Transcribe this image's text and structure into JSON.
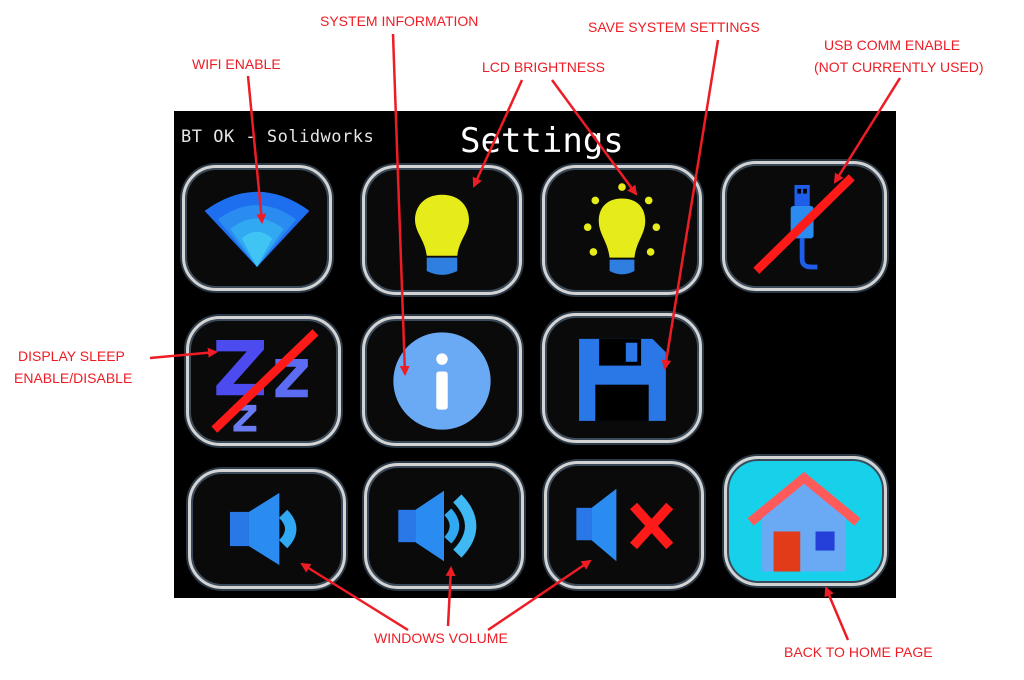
{
  "screen": {
    "status_text": "BT OK - Solidworks",
    "title": "Settings"
  },
  "buttons": [
    {
      "name": "wifi-toggle-button",
      "icon": "wifi-icon"
    },
    {
      "name": "lcd-brightness-down-button",
      "icon": "lightbulb-icon"
    },
    {
      "name": "lcd-brightness-up-button",
      "icon": "lightbulb-bright-icon"
    },
    {
      "name": "usb-comm-toggle-button",
      "icon": "usb-disabled-icon"
    },
    {
      "name": "display-sleep-toggle-button",
      "icon": "sleep-disabled-icon"
    },
    {
      "name": "system-info-button",
      "icon": "info-icon"
    },
    {
      "name": "save-settings-button",
      "icon": "floppy-disk-icon"
    },
    {
      "name": "volume-down-button",
      "icon": "speaker-low-icon"
    },
    {
      "name": "volume-up-button",
      "icon": "speaker-high-icon"
    },
    {
      "name": "volume-mute-button",
      "icon": "speaker-mute-icon"
    },
    {
      "name": "home-button",
      "icon": "house-icon"
    }
  ],
  "callouts": {
    "wifi": "WIFI ENABLE",
    "system_info": "SYSTEM INFORMATION",
    "lcd": "LCD BRIGHTNESS",
    "save": "SAVE SYSTEM SETTINGS",
    "usb_line1": "USB COMM ENABLE",
    "usb_line2": "(NOT CURRENTLY USED)",
    "sleep_line1": "DISPLAY SLEEP",
    "sleep_line2": "ENABLE/DISABLE",
    "volume": "WINDOWS VOLUME",
    "home": "BACK TO HOME PAGE"
  },
  "colors": {
    "accent_red": "#ee1c24",
    "icon_blue": "#2a8cf0",
    "bulb_yellow": "#e6eb1a",
    "home_cyan": "#17d0ea"
  }
}
